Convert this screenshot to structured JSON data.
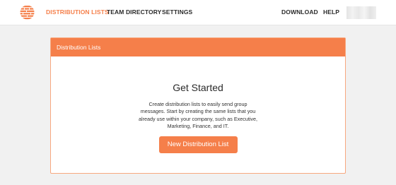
{
  "nav": {
    "links": [
      {
        "label": "DISTRIBUTION LISTS",
        "active": true
      },
      {
        "label": "TEAM DIRECTORY",
        "active": false
      },
      {
        "label": "SETTINGS",
        "active": false
      }
    ],
    "right_links": [
      {
        "label": "DOWNLOAD"
      },
      {
        "label": "HELP"
      }
    ]
  },
  "colors": {
    "accent": "#f57f4a",
    "background": "#f1f1f1",
    "text": "#2b2b2b"
  },
  "card": {
    "header_title": "Distribution Lists",
    "heading": "Get Started",
    "description": "Create distribution lists to easily send group messages. Start by creating the same lists that you already use within your company, such as Executive, Marketing, Finance, and IT.",
    "button_label": "New Distribution List"
  }
}
